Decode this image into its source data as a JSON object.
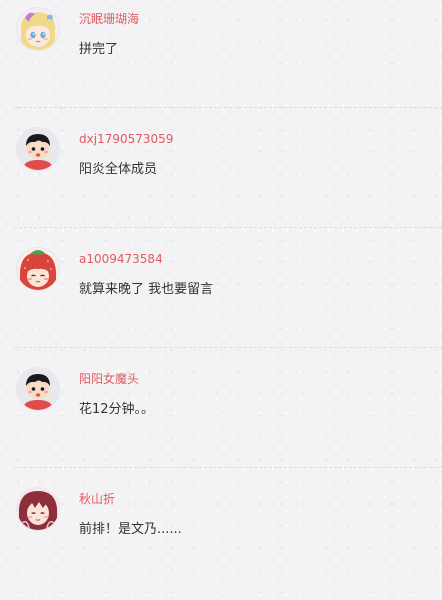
{
  "comments": [
    {
      "username": "沉眠珊瑚海",
      "text": "拼完了",
      "avatar": "anime-girl-blonde-avatar"
    },
    {
      "username": "dxj1790573059",
      "text": "阳炎全体成员",
      "avatar": "default-black-hair-avatar"
    },
    {
      "username": "a1009473584",
      "text": "就算来晚了 我也要留言",
      "avatar": "strawberry-girl-avatar"
    },
    {
      "username": "阳阳女魔头",
      "text": "花12分钟。。",
      "avatar": "default-black-hair-avatar"
    },
    {
      "username": "秋山折",
      "text": "前排！是文乃......",
      "avatar": "anime-girl-red-hair-avatar"
    }
  ],
  "colors": {
    "username": "#e15a5f",
    "text": "#333333",
    "background": "#f3f3f5"
  }
}
